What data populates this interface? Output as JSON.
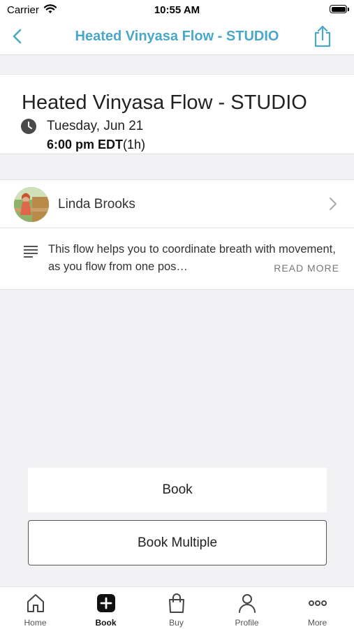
{
  "status_bar": {
    "carrier": "Carrier",
    "time": "10:55 AM"
  },
  "navbar": {
    "title": "Heated Vinyasa Flow - STUDIO",
    "accent_color": "#4aa8c6"
  },
  "class_info": {
    "title": "Heated Vinyasa Flow - STUDIO",
    "date": "Tuesday, Jun 21",
    "time": "6:00 pm EDT",
    "duration": "(1h)"
  },
  "instructor": {
    "name": "Linda Brooks"
  },
  "description": {
    "text": "This flow helps you to  coordinate breath with movement, as you flow from one pos…",
    "read_more": "READ MORE"
  },
  "actions": {
    "book_label": "Book",
    "book_multiple_label": "Book Multiple"
  },
  "tabbar": {
    "items": [
      {
        "label": "Home",
        "icon": "home-icon"
      },
      {
        "label": "Book",
        "icon": "plus-square-icon",
        "active": true
      },
      {
        "label": "Buy",
        "icon": "shopping-bag-icon"
      },
      {
        "label": "Profile",
        "icon": "person-icon"
      },
      {
        "label": "More",
        "icon": "ellipsis-icon"
      }
    ]
  }
}
